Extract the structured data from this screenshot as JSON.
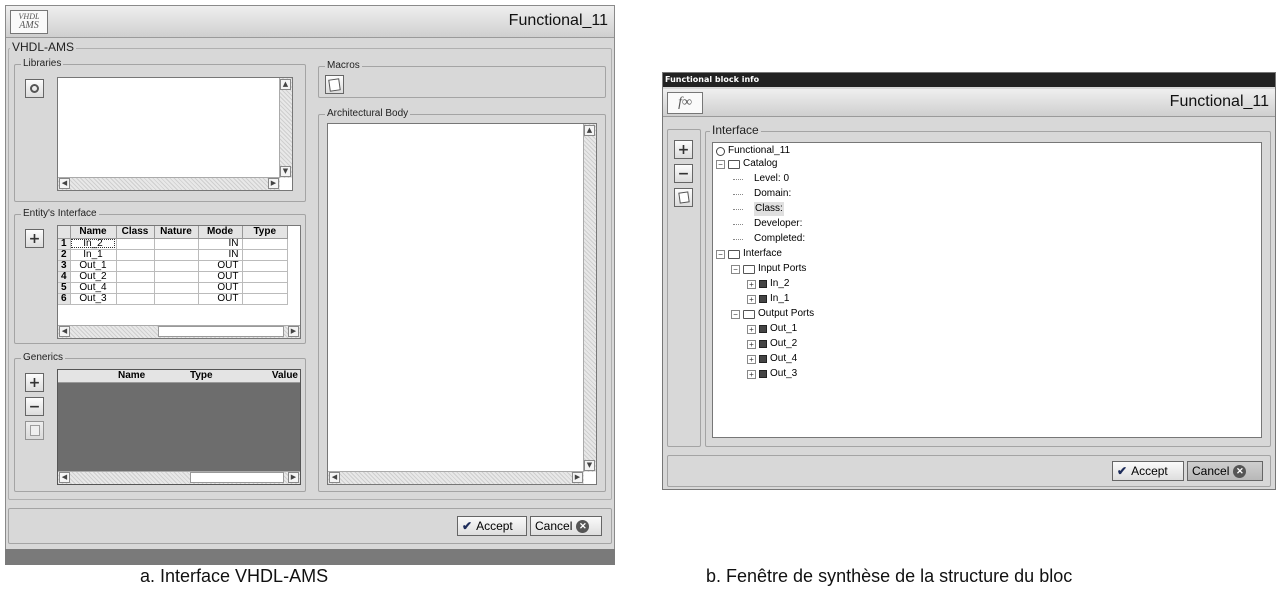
{
  "left_window": {
    "logo_line1": "VHDL",
    "logo_line2": "AMS",
    "title": "Functional_11",
    "group_label": "VHDL-AMS",
    "libraries_label": "Libraries",
    "macros_label": "Macros",
    "arch_body_label": "Architectural Body",
    "entity_label": "Entity's Interface",
    "entity_columns": [
      "Name",
      "Class",
      "Nature",
      "Mode",
      "Type"
    ],
    "entity_rows": [
      {
        "n": "1",
        "name": "In_2",
        "cls": "",
        "nature": "",
        "mode": "IN",
        "type": ""
      },
      {
        "n": "2",
        "name": "In_1",
        "cls": "",
        "nature": "",
        "mode": "IN",
        "type": ""
      },
      {
        "n": "3",
        "name": "Out_1",
        "cls": "",
        "nature": "",
        "mode": "OUT",
        "type": ""
      },
      {
        "n": "4",
        "name": "Out_2",
        "cls": "",
        "nature": "",
        "mode": "OUT",
        "type": ""
      },
      {
        "n": "5",
        "name": "Out_4",
        "cls": "",
        "nature": "",
        "mode": "OUT",
        "type": ""
      },
      {
        "n": "6",
        "name": "Out_3",
        "cls": "",
        "nature": "",
        "mode": "OUT",
        "type": ""
      }
    ],
    "generics_label": "Generics",
    "generics_columns": [
      "Name",
      "Type",
      "Value"
    ],
    "accept_label": "Accept",
    "cancel_label": "Cancel"
  },
  "right_window": {
    "window_title": "Functional block info",
    "logo": "f∞",
    "title": "Functional_11",
    "interface_label": "Interface",
    "tree": [
      {
        "label": "Functional_11",
        "level": 0,
        "kind": "root"
      },
      {
        "label": "Catalog",
        "level": 1,
        "kind": "folder"
      },
      {
        "label": "Level: 0",
        "level": 2,
        "kind": "leaf"
      },
      {
        "label": "Domain:",
        "level": 2,
        "kind": "leaf"
      },
      {
        "label": "Class:",
        "level": 2,
        "kind": "leaf",
        "selected": true
      },
      {
        "label": "Developer:",
        "level": 2,
        "kind": "leaf"
      },
      {
        "label": "Completed:",
        "level": 2,
        "kind": "leaf"
      },
      {
        "label": "Interface",
        "level": 1,
        "kind": "folder"
      },
      {
        "label": "Input Ports",
        "level": 2,
        "kind": "folder"
      },
      {
        "label": "In_2",
        "level": 3,
        "kind": "port"
      },
      {
        "label": "In_1",
        "level": 3,
        "kind": "port"
      },
      {
        "label": "Output Ports",
        "level": 2,
        "kind": "folder"
      },
      {
        "label": "Out_1",
        "level": 3,
        "kind": "port"
      },
      {
        "label": "Out_2",
        "level": 3,
        "kind": "port"
      },
      {
        "label": "Out_4",
        "level": 3,
        "kind": "port"
      },
      {
        "label": "Out_3",
        "level": 3,
        "kind": "port"
      }
    ],
    "accept_label": "Accept",
    "cancel_label": "Cancel"
  },
  "captions": {
    "a": "a. Interface VHDL-AMS",
    "b": "b. Fenêtre de synthèse de la structure du bloc"
  },
  "icons": [
    "search-icon",
    "macro-edit-icon",
    "plus-icon",
    "minus-icon",
    "edit-icon",
    "checkmark-icon",
    "cancel-x-icon",
    "folder-icon",
    "port-icon"
  ],
  "colors": {
    "window_bg": "#d8d8d8",
    "dark_panel": "#6d6d6d",
    "title_bar": "#222222"
  }
}
